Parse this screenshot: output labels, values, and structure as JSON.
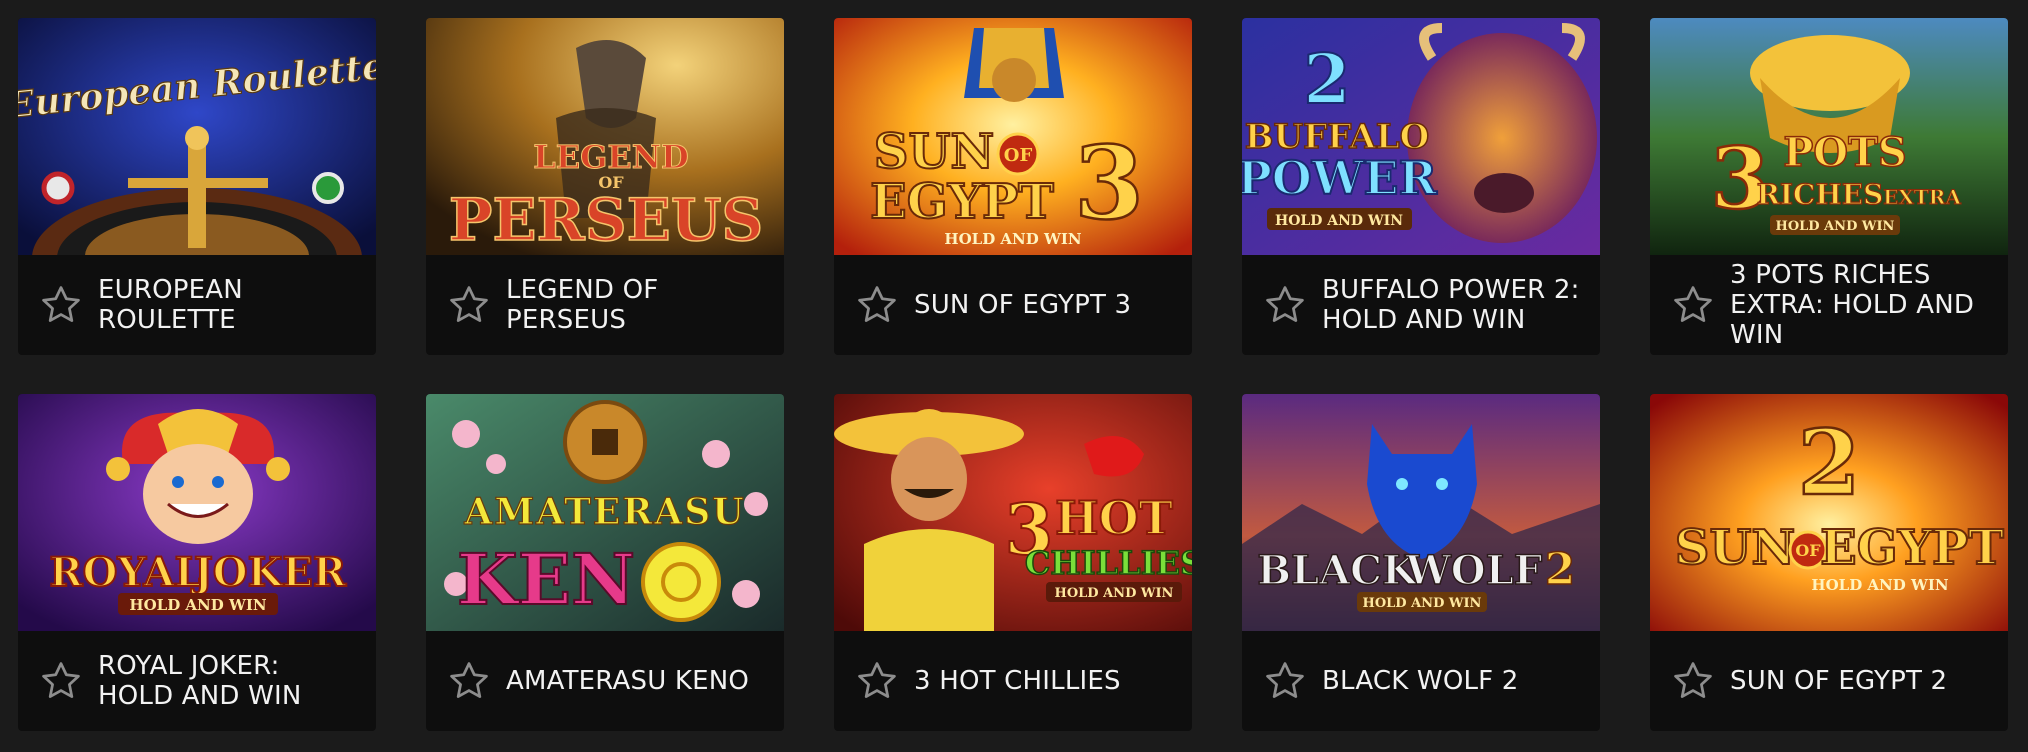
{
  "games": [
    {
      "title": "EUROPEAN ROULETTE",
      "art": {
        "line1": "European Roulette"
      },
      "colors": {
        "bg1": "#1b2a8a",
        "bg2": "#0a0f3a"
      }
    },
    {
      "title": "LEGEND OF PERSEUS",
      "art": {
        "line1": "LEGEND",
        "line2": "OF",
        "line3": "PERSEUS"
      },
      "colors": {
        "bg1": "#c8902e",
        "bg2": "#3a2410"
      }
    },
    {
      "title": "SUN OF EGYPT 3",
      "art": {
        "line1": "SUN",
        "line2": "OF",
        "line3": "EGYPT",
        "line4": "3",
        "sub": "HOLD AND WIN"
      },
      "colors": {
        "bg1": "#ffcc33",
        "bg2": "#c2380e"
      }
    },
    {
      "title": "BUFFALO POWER 2: HOLD AND WIN",
      "art": {
        "line1": "2",
        "line2": "BUFFALO",
        "line3": "POWER",
        "sub": "HOLD AND WIN"
      },
      "colors": {
        "bg1": "#3b3fa8",
        "bg2": "#121450"
      }
    },
    {
      "title": "3 POTS RICHES EXTRA: HOLD AND WIN",
      "art": {
        "line1": "3",
        "line2": "POTS",
        "line3": "RICHES",
        "line4": "EXTRA",
        "sub": "HOLD AND WIN"
      },
      "colors": {
        "bg1": "#3e7a35",
        "bg2": "#14301a"
      }
    },
    {
      "title": "ROYAL JOKER: HOLD AND WIN",
      "art": {
        "line1": "ROYAL",
        "line2": "JOKER",
        "sub": "HOLD AND WIN"
      },
      "colors": {
        "bg1": "#6a1fa8",
        "bg2": "#2a0c55"
      }
    },
    {
      "title": "AMATERASU KENO",
      "art": {
        "line1": "AMATERASU",
        "line2": "KEN"
      },
      "colors": {
        "bg1": "#3c6e4e",
        "bg2": "#1a2c2a"
      }
    },
    {
      "title": "3 HOT CHILLIES",
      "art": {
        "line1": "3",
        "line2": "HOT",
        "line3": "CHILLIES",
        "sub": "HOLD AND WIN"
      },
      "colors": {
        "bg1": "#c5231a",
        "bg2": "#4e0a08"
      }
    },
    {
      "title": "BLACK WOLF 2",
      "art": {
        "line1": "BLACK",
        "line2": "WOLF",
        "line3": "2",
        "sub": "HOLD AND WIN"
      },
      "colors": {
        "bg1": "#6a3c8a",
        "bg2": "#d36a3a"
      }
    },
    {
      "title": "SUN OF EGYPT 2",
      "art": {
        "line1": "2",
        "line2": "SUN",
        "line3": "OF",
        "line4": "EGYPT",
        "sub": "HOLD AND WIN"
      },
      "colors": {
        "bg1": "#ff9a2a",
        "bg2": "#a10d0d"
      }
    }
  ]
}
